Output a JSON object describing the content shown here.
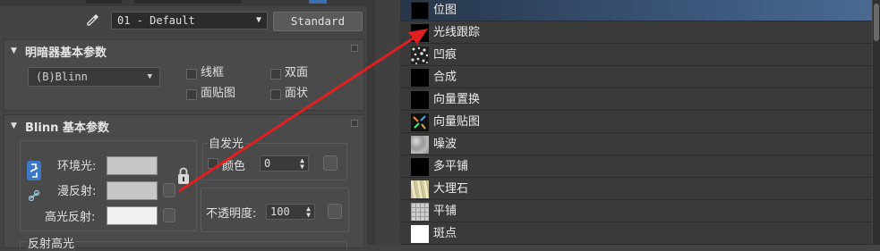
{
  "toolbar": {
    "material_name": "01 - Default",
    "type_button": "Standard"
  },
  "shader_rollout": {
    "title": "明暗器基本参数",
    "shader_value": "(B)Blinn",
    "options": [
      "线框",
      "双面",
      "面贴图",
      "面状"
    ]
  },
  "blinn_rollout": {
    "title": "Blinn 基本参数",
    "ambient_label": "环境光:",
    "diffuse_label": "漫反射:",
    "specular_label": "高光反射:",
    "self_illum_title": "自发光",
    "color_checkbox_label": "颜色",
    "color_value": "0",
    "opacity_label": "不透明度:",
    "opacity_value": "100",
    "reflect_title": "反射高光",
    "colors": {
      "ambient": "#c6c6c6",
      "diffuse": "#c6c6c6",
      "specular": "#f0f0f0"
    }
  },
  "map_list": {
    "items": [
      {
        "label": "位图",
        "icon": "black-thumb",
        "selected": true
      },
      {
        "label": "光线跟踪",
        "icon": "black-thumb"
      },
      {
        "label": "凹痕",
        "icon": "dent-thumb"
      },
      {
        "label": "合成",
        "icon": "black-thumb"
      },
      {
        "label": "向量置换",
        "icon": "black-thumb"
      },
      {
        "label": "向量贴图",
        "icon": "vector-map-thumb"
      },
      {
        "label": "噪波",
        "icon": "noise-thumb"
      },
      {
        "label": "多平铺",
        "icon": "black-thumb"
      },
      {
        "label": "大理石",
        "icon": "marble-thumb"
      },
      {
        "label": "平铺",
        "icon": "tiles-thumb"
      },
      {
        "label": "斑点",
        "icon": "white-thumb"
      }
    ],
    "selection_color": "#3a5578"
  },
  "annotation": {
    "arrow_color": "#e02020"
  }
}
